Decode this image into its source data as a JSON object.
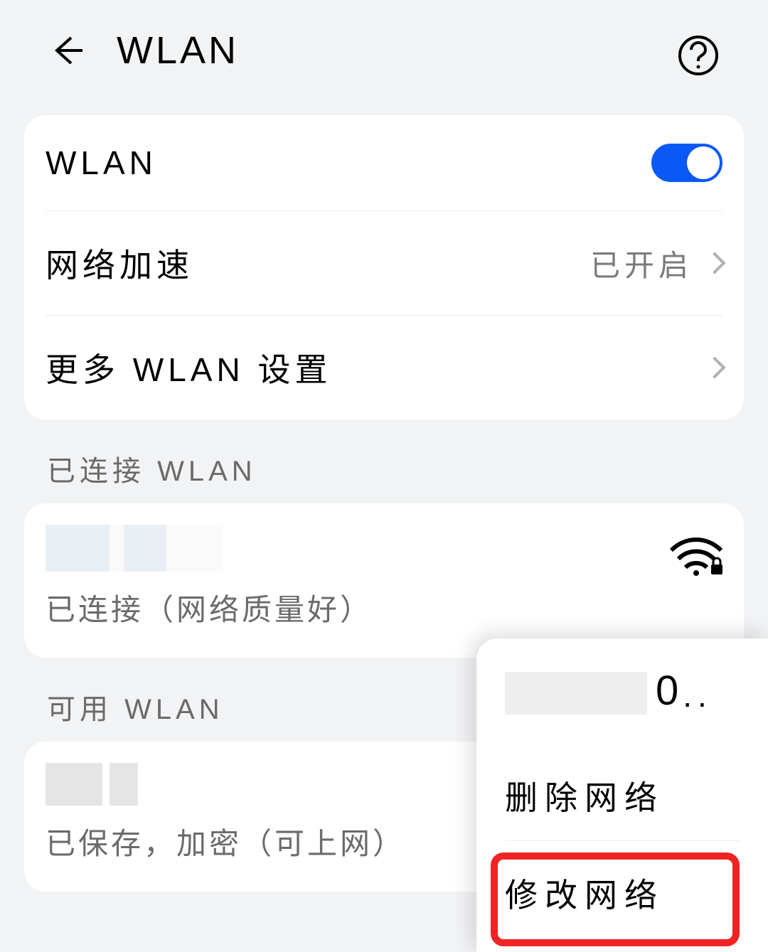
{
  "header": {
    "title": "WLAN"
  },
  "settings": {
    "wlan_label": "WLAN",
    "wlan_on": true,
    "net_boost_label": "网络加速",
    "net_boost_value": "已开启",
    "more_label": "更多 WLAN 设置"
  },
  "sections": {
    "connected_title": "已连接 WLAN",
    "available_title": "可用 WLAN"
  },
  "connected": {
    "status": "已连接（网络质量好）"
  },
  "available": {
    "status": "已保存，加密（可上网）"
  },
  "popup": {
    "title_suffix": "0",
    "title_dots": "..",
    "delete_label": "删除网络",
    "modify_label": "修改网络"
  }
}
